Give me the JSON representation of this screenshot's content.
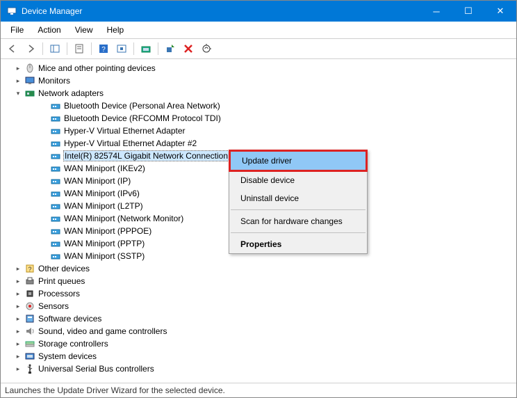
{
  "window": {
    "title": "Device Manager"
  },
  "menu": [
    "File",
    "Action",
    "View",
    "Help"
  ],
  "tree": {
    "categories": [
      {
        "label": "Mice and other pointing devices",
        "icon": "mouse",
        "expander": ">",
        "children": []
      },
      {
        "label": "Monitors",
        "icon": "monitor",
        "expander": ">",
        "children": []
      },
      {
        "label": "Network adapters",
        "icon": "netcard",
        "expander": "v",
        "children": [
          {
            "label": "Bluetooth Device (Personal Area Network)",
            "icon": "net"
          },
          {
            "label": "Bluetooth Device (RFCOMM Protocol TDI)",
            "icon": "net"
          },
          {
            "label": "Hyper-V Virtual Ethernet Adapter",
            "icon": "net"
          },
          {
            "label": "Hyper-V Virtual Ethernet Adapter #2",
            "icon": "net"
          },
          {
            "label": "Intel(R) 82574L Gigabit Network Connection",
            "icon": "net",
            "selected": true
          },
          {
            "label": "WAN Miniport (IKEv2)",
            "icon": "net"
          },
          {
            "label": "WAN Miniport (IP)",
            "icon": "net"
          },
          {
            "label": "WAN Miniport (IPv6)",
            "icon": "net"
          },
          {
            "label": "WAN Miniport (L2TP)",
            "icon": "net"
          },
          {
            "label": "WAN Miniport (Network Monitor)",
            "icon": "net"
          },
          {
            "label": "WAN Miniport (PPPOE)",
            "icon": "net"
          },
          {
            "label": "WAN Miniport (PPTP)",
            "icon": "net"
          },
          {
            "label": "WAN Miniport (SSTP)",
            "icon": "net"
          }
        ]
      },
      {
        "label": "Other devices",
        "icon": "other",
        "expander": ">",
        "children": []
      },
      {
        "label": "Print queues",
        "icon": "printer",
        "expander": ">",
        "children": []
      },
      {
        "label": "Processors",
        "icon": "cpu",
        "expander": ">",
        "children": []
      },
      {
        "label": "Sensors",
        "icon": "sensor",
        "expander": ">",
        "children": []
      },
      {
        "label": "Software devices",
        "icon": "software",
        "expander": ">",
        "children": []
      },
      {
        "label": "Sound, video and game controllers",
        "icon": "sound",
        "expander": ">",
        "children": []
      },
      {
        "label": "Storage controllers",
        "icon": "storage",
        "expander": ">",
        "children": []
      },
      {
        "label": "System devices",
        "icon": "system",
        "expander": ">",
        "children": []
      },
      {
        "label": "Universal Serial Bus controllers",
        "icon": "usb",
        "expander": ">",
        "children": []
      }
    ]
  },
  "context_menu": [
    {
      "label": "Update driver",
      "highlight": true
    },
    {
      "label": "Disable device"
    },
    {
      "label": "Uninstall device"
    },
    {
      "sep": true
    },
    {
      "label": "Scan for hardware changes"
    },
    {
      "sep": true
    },
    {
      "label": "Properties",
      "bold": true
    }
  ],
  "statusbar": "Launches the Update Driver Wizard for the selected device."
}
